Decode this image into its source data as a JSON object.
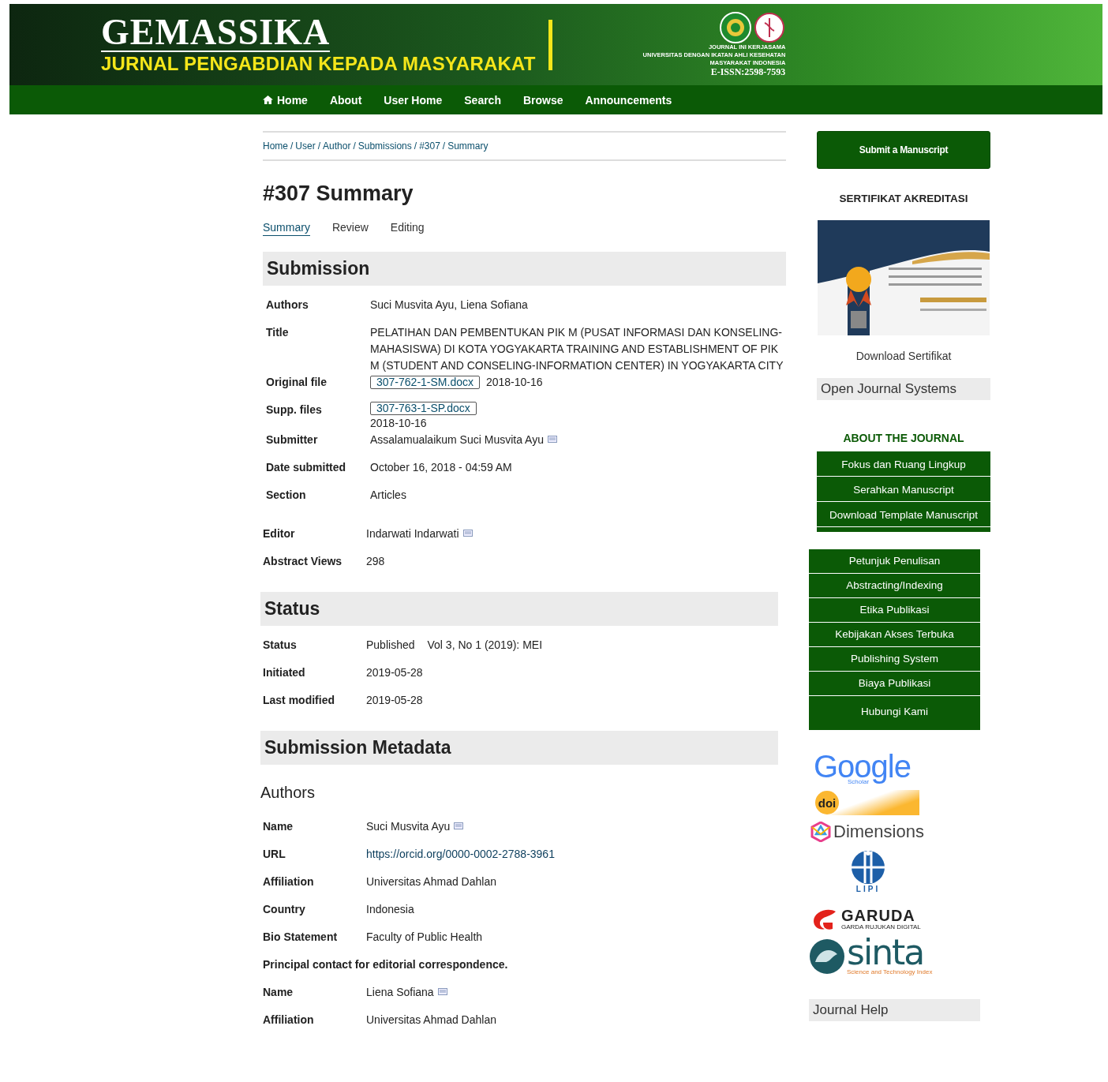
{
  "header": {
    "title": "GEMASSIKA",
    "subtitle": "JURNAL PENGABDIAN KEPADA MASYARAKAT",
    "partner_lines": [
      "JOURNAL INI KERJASAMA",
      "UNIVERSITAS DENGAN IKATAN AHLI KESEHATAN",
      "MASYARAKAT INDONESIA"
    ],
    "issn": "E-ISSN:2598-7593"
  },
  "nav": [
    {
      "label": "Home",
      "kind": "home"
    },
    {
      "label": "About",
      "kind": "link"
    },
    {
      "label": "User Home",
      "kind": "link"
    },
    {
      "label": "Search",
      "kind": "link"
    },
    {
      "label": "Browse",
      "kind": "link"
    },
    {
      "label": "Announcements",
      "kind": "link"
    }
  ],
  "breadcrumb": [
    "Home",
    "User",
    "Author",
    "Submissions",
    "#307",
    "Summary"
  ],
  "breadcrumb_separator": "/",
  "page_title": "#307 Summary",
  "tabs": [
    {
      "label": "Summary",
      "selected": true
    },
    {
      "label": "Review",
      "selected": false
    },
    {
      "label": "Editing",
      "selected": false
    }
  ],
  "submission": {
    "heading": "Submission",
    "rows": [
      {
        "label": "Authors",
        "value": "Suci Musvita Ayu, Liena Sofiana",
        "kind": "text",
        "mail": false
      },
      {
        "label": "Title",
        "value": "PELATIHAN DAN PEMBENTUKAN PIK M (PUSAT INFORMASI DAN KONSELING-MAHASISWA) DI KOTA YOGYAKARTA TRAINING AND ESTABLISHMENT OF PIK M (STUDENT AND CONSELING-INFORMATION CENTER) IN YOGYAKARTA CITY",
        "kind": "text",
        "mail": false
      },
      {
        "label": "Original file",
        "file": "307-762-1-SM.docx",
        "value": "2018-10-16",
        "kind": "file",
        "mail": false
      },
      {
        "label": "Supp. files",
        "file": "307-763-1-SP.docx",
        "value": "2018-10-16",
        "kind": "file-narrow",
        "mail": false
      },
      {
        "label": "Submitter",
        "value": "Assalamualaikum Suci Musvita Ayu",
        "kind": "text",
        "mail": true
      },
      {
        "label": "Date submitted",
        "value": "October 16, 2018 - 04:59 AM",
        "kind": "text",
        "mail": false
      },
      {
        "label": "Section",
        "value": "Articles",
        "kind": "text",
        "mail": false
      }
    ],
    "extra_rows": [
      {
        "label": "Editor",
        "value": "Indarwati Indarwati",
        "mail": true
      },
      {
        "label": "Abstract Views",
        "value": "298",
        "mail": false
      }
    ]
  },
  "status": {
    "heading": "Status",
    "rows": [
      {
        "label": "Status",
        "value": "Published",
        "extra": "Vol 3, No 1 (2019): MEI"
      },
      {
        "label": "Initiated",
        "value": "2019-05-28"
      },
      {
        "label": "Last modified",
        "value": "2019-05-28"
      }
    ]
  },
  "metadata": {
    "heading": "Submission Metadata",
    "subheading": "Authors",
    "rows": [
      {
        "label": "Name",
        "value": "Suci Musvita Ayu",
        "kind": "text",
        "mail": true
      },
      {
        "label": "URL",
        "value": "https://orcid.org/0000-0002-2788-3961",
        "kind": "link",
        "mail": false
      },
      {
        "label": "Affiliation",
        "value": "Universitas Ahmad Dahlan",
        "kind": "text",
        "mail": false
      },
      {
        "label": "Country",
        "value": "Indonesia",
        "kind": "text",
        "mail": false
      },
      {
        "label": "Bio Statement",
        "value": "Faculty of Public Health",
        "kind": "text",
        "mail": false
      },
      {
        "label": "Principal contact for editorial correspondence.",
        "kind": "note",
        "mail": false
      },
      {
        "label": "Name",
        "value": "Liena Sofiana",
        "kind": "text",
        "mail": true
      },
      {
        "label": "Affiliation",
        "value": "Universitas Ahmad Dahlan",
        "kind": "text",
        "mail": false
      }
    ]
  },
  "sidebar": {
    "submit_button": "Submit a Manuscript",
    "cert_heading": "SERTIFIKAT AKREDITASI",
    "cert_link": "Download Sertifikat",
    "ojs": "Open Journal Systems",
    "about_heading": "ABOUT THE JOURNAL",
    "about_menu": [
      "Fokus dan Ruang Lingkup",
      "Serahkan Manuscript",
      "Download Template Manuscript"
    ],
    "menu": [
      "Petunjuk Penulisan",
      "Abstracting/Indexing",
      "Etika Publikasi",
      "Kebijakan Akses Terbuka",
      "Publishing System",
      "Biaya Publikasi",
      "Hubungi Kami"
    ],
    "logos": [
      {
        "kind": "google",
        "text": "Google",
        "sub": "Scholar"
      },
      {
        "kind": "doi",
        "text": "doi"
      },
      {
        "kind": "dimensions",
        "text": "Dimensions"
      },
      {
        "kind": "lipi",
        "text": "LIPI"
      },
      {
        "kind": "garuda",
        "text": "GARUDA",
        "sub": "GARDA RUJUKAN DIGITAL"
      },
      {
        "kind": "sinta",
        "text": "sinta",
        "sub": "Science and Technology Index"
      }
    ],
    "help": "Journal Help"
  }
}
